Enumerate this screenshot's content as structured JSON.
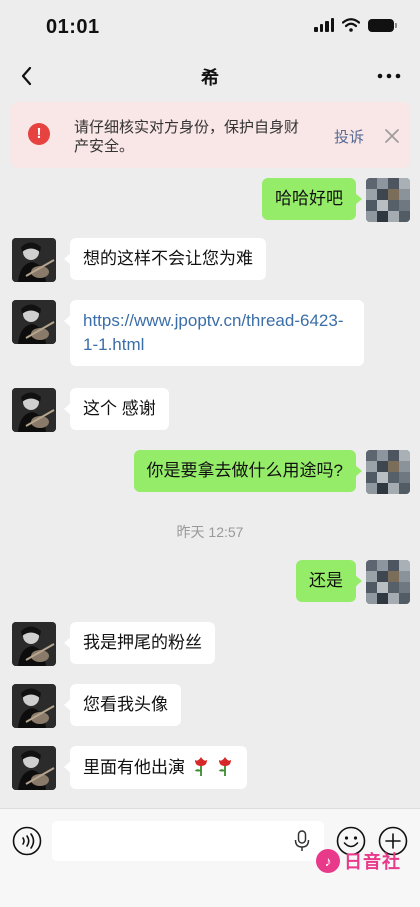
{
  "status_bar": {
    "time": "01:01"
  },
  "nav": {
    "title": "希"
  },
  "warning": {
    "text": "请仔细核实对方身份，保护自身财产安全。",
    "report_label": "投诉",
    "color": "#e64340"
  },
  "messages": [
    {
      "side": "right",
      "text": "哈哈好吧"
    },
    {
      "side": "left",
      "text": "想的这样不会让您为难"
    },
    {
      "side": "left",
      "text": "https://www.jpoptv.cn/thread-6423-1-1.html",
      "type": "link"
    },
    {
      "side": "left",
      "text": "这个 感谢"
    },
    {
      "side": "right",
      "text": "你是要拿去做什么用途吗?"
    },
    {
      "type": "timestamp",
      "text": "昨天 12:57"
    },
    {
      "side": "right",
      "text": "还是"
    },
    {
      "side": "left",
      "text": "我是押尾的粉丝"
    },
    {
      "side": "left",
      "text": "您看我头像"
    },
    {
      "side": "left",
      "text": "里面有他出演",
      "emoji": [
        "rose-icon",
        "rose-icon"
      ]
    }
  ],
  "colors": {
    "sent_bubble": "#95ec69",
    "received_bubble": "#ffffff",
    "background": "#ededed",
    "link": "#3b6ea8"
  },
  "watermark": {
    "text": "日音社"
  }
}
